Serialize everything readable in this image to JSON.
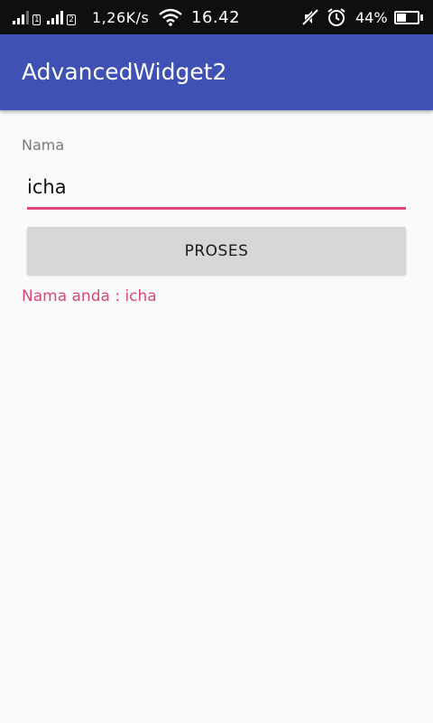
{
  "status_bar": {
    "sim1_badge": "1",
    "sim2_badge": "2",
    "net_speed": "1,26K/s",
    "time": "16.42",
    "battery_percent": "44%",
    "battery_level": 0.44,
    "icons": [
      "signal-icon",
      "signal-icon",
      "wifi-icon",
      "mute-icon",
      "alarm-icon",
      "battery-icon"
    ]
  },
  "app_bar": {
    "title": "AdvancedWidget2",
    "color": "#3f51b5"
  },
  "form": {
    "label": "Nama",
    "input_value": "icha",
    "button_label": "PROSES",
    "result": "Nama anda : icha",
    "accent_color": "#e0457b"
  }
}
